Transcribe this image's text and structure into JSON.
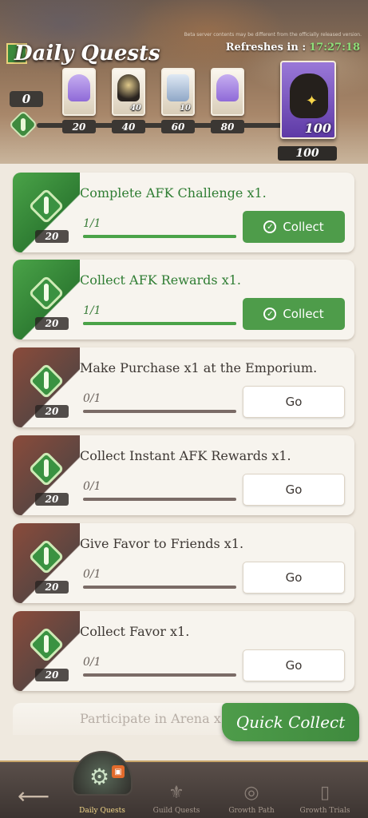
{
  "header": {
    "disclaimer": "Beta server contents may be different from the officially released version.",
    "title": "Daily Quests",
    "refresh_label": "Refreshes in :",
    "refresh_time": "17:27:18",
    "current_points": "0"
  },
  "milestones": [
    {
      "label": "20",
      "reward_icon": "purple-potion-icon",
      "badge": ""
    },
    {
      "label": "40",
      "reward_icon": "crystal-bag-icon",
      "badge": "40"
    },
    {
      "label": "60",
      "reward_icon": "silver-crystal-icon",
      "badge": "10"
    },
    {
      "label": "80",
      "reward_icon": "purple-potion-icon",
      "badge": ""
    },
    {
      "label": "100",
      "reward_icon": "crystal-bag-icon",
      "badge": "100"
    }
  ],
  "quests": [
    {
      "title": "Complete AFK Challenge x1.",
      "progress": "1/1",
      "points": "20",
      "button": "Collect",
      "done": true
    },
    {
      "title": "Collect AFK Rewards x1.",
      "progress": "1/1",
      "points": "20",
      "button": "Collect",
      "done": true
    },
    {
      "title": "Make Purchase x1 at the Emporium.",
      "progress": "0/1",
      "points": "20",
      "button": "Go",
      "done": false
    },
    {
      "title": "Collect Instant AFK Rewards x1.",
      "progress": "0/1",
      "points": "20",
      "button": "Go",
      "done": false
    },
    {
      "title": "Give Favor to Friends x1.",
      "progress": "0/1",
      "points": "20",
      "button": "Go",
      "done": false
    },
    {
      "title": "Collect Favor x1.",
      "progress": "0/1",
      "points": "20",
      "button": "Go",
      "done": false
    },
    {
      "title": "Participate in Arena x",
      "progress": "",
      "points": "",
      "button": "",
      "done": false
    }
  ],
  "quick_collect": "Quick Collect",
  "nav": {
    "items": [
      {
        "label": "Daily Quests",
        "icon": "gear-icon",
        "active": true
      },
      {
        "label": "Guild Quests",
        "icon": "guild-crest-icon",
        "active": false
      },
      {
        "label": "Growth Path",
        "icon": "compass-icon",
        "active": false
      },
      {
        "label": "Growth Trials",
        "icon": "scroll-icon",
        "active": false
      }
    ]
  },
  "colors": {
    "accent_green": "#4e9c4a",
    "done_text": "#2f7d33",
    "header_brown": "#8b6e55"
  }
}
